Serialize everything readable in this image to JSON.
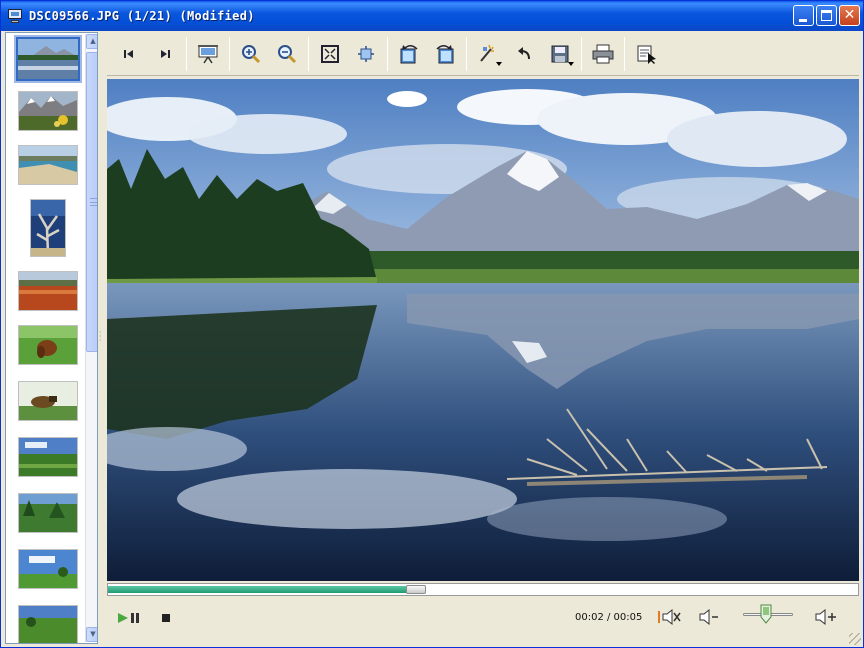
{
  "window": {
    "title": "DSC09566.JPG (1/21) (Modified)",
    "controls": [
      "minimize-icon",
      "maximize-icon",
      "close-icon"
    ]
  },
  "toolbar": {
    "buttons": [
      {
        "name": "previous-image",
        "icon": "skip-back-icon"
      },
      {
        "name": "next-image",
        "icon": "skip-forward-icon"
      },
      {
        "name": "slideshow",
        "icon": "presentation-icon"
      },
      {
        "name": "zoom-in",
        "icon": "zoom-in-icon"
      },
      {
        "name": "zoom-out",
        "icon": "zoom-out-icon"
      },
      {
        "name": "fit-to-window",
        "icon": "fit-window-icon"
      },
      {
        "name": "actual-size",
        "icon": "actual-size-icon"
      },
      {
        "name": "rotate-left",
        "icon": "rotate-left-icon"
      },
      {
        "name": "rotate-right",
        "icon": "rotate-right-icon"
      },
      {
        "name": "correct-image",
        "icon": "wand-icon"
      },
      {
        "name": "undo",
        "icon": "undo-icon"
      },
      {
        "name": "save",
        "icon": "floppy-disk-icon"
      },
      {
        "name": "print",
        "icon": "printer-icon"
      },
      {
        "name": "properties",
        "icon": "properties-icon"
      }
    ]
  },
  "thumbnails": {
    "count_visible": 11,
    "selected_index": 0
  },
  "playback": {
    "time_display": "00:02 / 00:05",
    "progress": 0.4,
    "volume": 0.45
  },
  "colors": {
    "title_bar": "#0a57de",
    "progress_fill": "#1f9a74",
    "window_bg": "#ece9d8"
  }
}
